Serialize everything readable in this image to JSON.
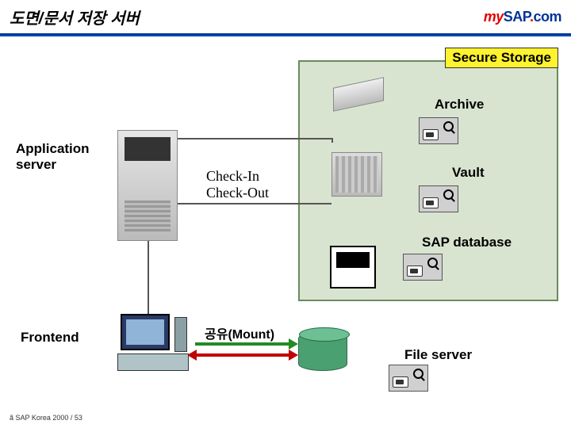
{
  "header": {
    "title": "도면/문서 저장 서버",
    "logo": {
      "my": "my",
      "sap": "SAP",
      "dot": ".",
      "com": "com"
    }
  },
  "secure_storage": {
    "label": "Secure Storage",
    "archive": "Archive",
    "vault": "Vault",
    "sap_database": "SAP database"
  },
  "nodes": {
    "application_server": "Application\nserver",
    "frontend": "Frontend",
    "file_server": "File server"
  },
  "flows": {
    "check_in": "Check-In",
    "check_out": "Check-Out",
    "mount": "공유(Mount)"
  },
  "footer": "ã SAP Korea 2000 / 53"
}
